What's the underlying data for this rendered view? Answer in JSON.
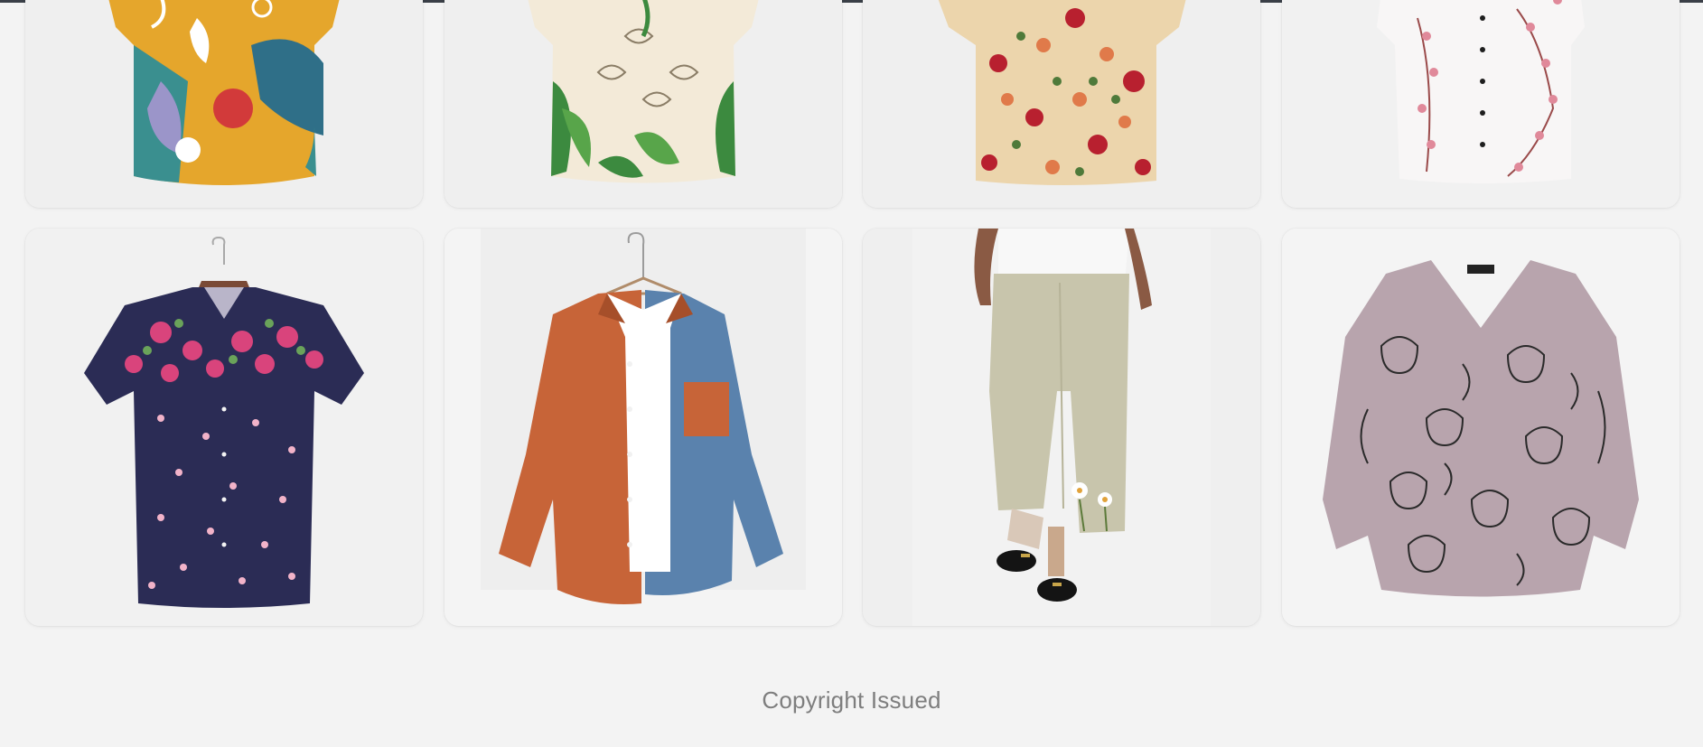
{
  "products": [
    {
      "name": "Abstract floral print short-sleeve shirt",
      "icon": "product-image"
    },
    {
      "name": "Lily leaf print short-sleeve shirt",
      "icon": "product-image"
    },
    {
      "name": "Rose floral print short-sleeve shirt",
      "icon": "product-image"
    },
    {
      "name": "White cherry blossom print blouse",
      "icon": "product-image"
    },
    {
      "name": "Navy floral print short-sleeve shirt",
      "icon": "product-image"
    },
    {
      "name": "Orange and blue corduroy patchwork shirt",
      "icon": "product-image"
    },
    {
      "name": "Linen wide-leg pants with floral embroidery",
      "icon": "product-image"
    },
    {
      "name": "Cat print V-neck long-sleeve top",
      "icon": "product-image"
    }
  ],
  "footer": {
    "copyright": "Copyright Issued"
  },
  "colors": {
    "background": "#f3f3f3",
    "card": "#f0f0f0",
    "footer_text": "#7e7e7e",
    "top_bar": "#3a3f47"
  }
}
